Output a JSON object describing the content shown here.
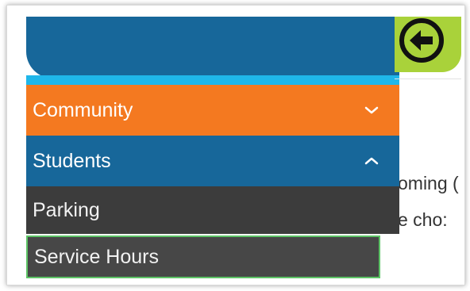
{
  "header": {
    "back_icon": "back-arrow-icon",
    "colors": {
      "bar": "#17679a",
      "strip": "#1fb7ea",
      "back_area": "#a9d23a"
    }
  },
  "menu": {
    "items": [
      {
        "label": "Community",
        "state": "collapsed",
        "icon": "chevron-down-icon",
        "color": "#f47920"
      },
      {
        "label": "Students",
        "state": "expanded",
        "icon": "chevron-up-icon",
        "color": "#17679a"
      }
    ],
    "subitems": [
      {
        "label": "Parking",
        "color": "#3c3c3c"
      },
      {
        "label": "Service Hours",
        "color": "#474747",
        "focused": true
      }
    ]
  },
  "background_text": {
    "line1": "oming (",
    "line2": "e cho:"
  }
}
